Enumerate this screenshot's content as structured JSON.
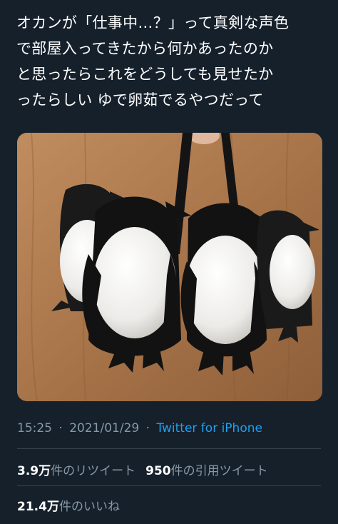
{
  "tweet": {
    "lines": [
      "オカンが「仕事中…？」って真剣な声色",
      "で部屋入ってきたから何かあったのか",
      "と思ったらこれをどうしても見せたか",
      "ったらしい ゆで卵茹でるやつだって"
    ]
  },
  "media": {
    "description_icon": "penguin-egg-holder-photo"
  },
  "meta": {
    "time": "15:25",
    "separator": "·",
    "date": "2021/01/29",
    "source": "Twitter for iPhone"
  },
  "stats": {
    "retweets_count": "3.9万",
    "retweets_label": "件のリツイート",
    "quotes_count": "950",
    "quotes_label": "件の引用ツイート",
    "likes_count": "21.4万",
    "likes_label": "件のいいね"
  },
  "colors": {
    "background": "#15202b",
    "text": "#ffffff",
    "muted": "#8899a6",
    "link": "#1da1f2",
    "divider": "#38444d"
  }
}
